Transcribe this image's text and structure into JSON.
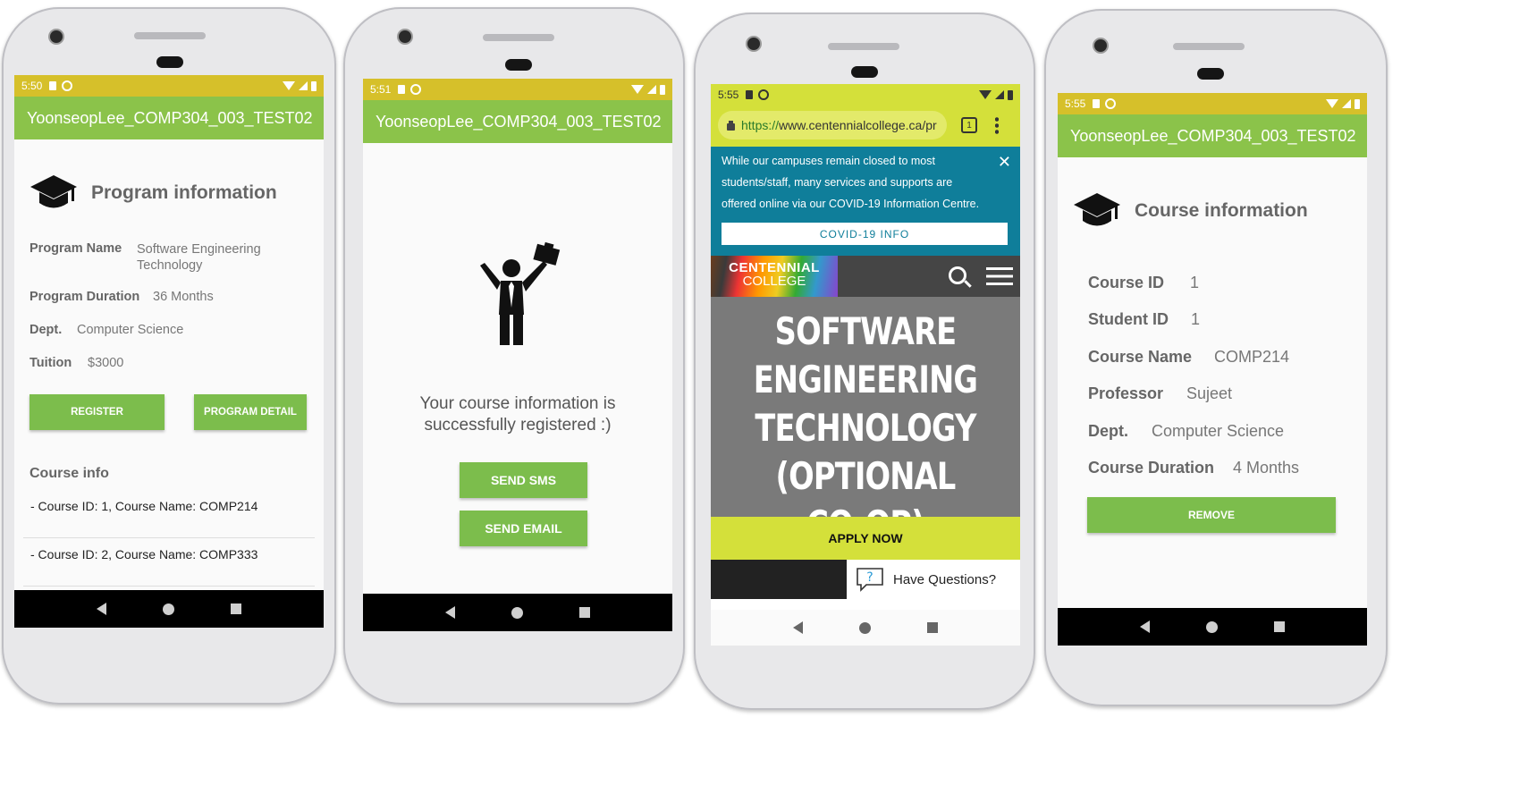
{
  "phone1": {
    "time": "5:50",
    "app_title": "YoonseopLee_COMP304_003_TEST02",
    "heading": "Program information",
    "fields": [
      {
        "label": "Program Name",
        "value": "Software Engineering Technology"
      },
      {
        "label": "Program Duration",
        "value": "36 Months"
      },
      {
        "label": "Dept.",
        "value": "Computer Science"
      },
      {
        "label": "Tuition",
        "value": "$3000"
      }
    ],
    "register_label": "REGISTER",
    "program_detail_label": "PROGRAM DETAIL",
    "course_info_heading": "Course info",
    "courses": [
      " - Course ID: 1, Course Name: COMP214",
      " - Course ID: 2, Course Name: COMP333"
    ]
  },
  "phone2": {
    "time": "5:51",
    "app_title": "YoonseopLee_COMP304_003_TEST02",
    "message": "Your course information is successfully registered :)",
    "send_sms_label": "SEND SMS",
    "send_email_label": "SEND EMAIL"
  },
  "phone3": {
    "time": "5:55",
    "url_https": "https://",
    "url_rest": "www.centennialcollege.ca/pr",
    "tab_count": "1",
    "banner_text": "While our campuses remain closed to most students/staff, many services and supports are offered online via our COVID-19 Information Centre.",
    "covid_button": "COVID-19 INFO",
    "logo_line1": "CENTENNIAL",
    "logo_line2": "COLLEGE",
    "hero_text": "SOFTWARE ENGINEERING TECHNOLOGY (OPTIONAL CO-OP)",
    "apply_label": "APPLY NOW",
    "questions_label": "Have Questions?"
  },
  "phone4": {
    "time": "5:55",
    "app_title": "YoonseopLee_COMP304_003_TEST02",
    "heading": "Course information",
    "fields": [
      {
        "label": "Course ID",
        "value": "1"
      },
      {
        "label": "Student ID",
        "value": "1"
      },
      {
        "label": "Course Name",
        "value": "COMP214"
      },
      {
        "label": "Professor",
        "value": "Sujeet"
      },
      {
        "label": "Dept.",
        "value": "Computer Science"
      },
      {
        "label": "Course Duration",
        "value": "4 Months"
      }
    ],
    "remove_label": "REMOVE"
  },
  "colors": {
    "status_bar": "#d6c02a",
    "app_bar": "#8bc34a",
    "button": "#7cbd4c",
    "chrome_bar": "#d4e03a",
    "banner": "#0f7e9a",
    "apply_bar": "#d4e03a"
  },
  "icons": [
    "graduation-cap-icon",
    "celebrating-person-icon",
    "search-icon",
    "menu-icon",
    "question-chat-icon",
    "lock-icon"
  ]
}
